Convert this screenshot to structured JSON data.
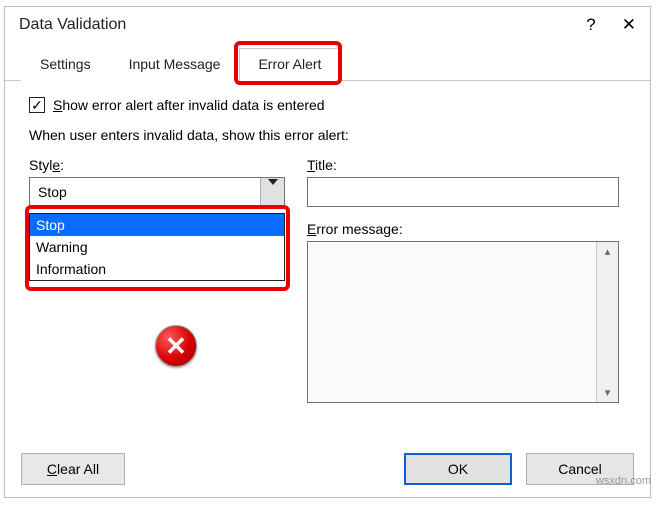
{
  "titlebar": {
    "title": "Data Validation"
  },
  "tabs": {
    "settings": "Settings",
    "input_message": "Input Message",
    "error_alert": "Error Alert"
  },
  "checkbox": {
    "prefix": "S",
    "rest": "how error alert after invalid data is entered"
  },
  "instruction": "When user enters invalid data, show this error alert:",
  "style": {
    "label_prefix": "Styl",
    "label_u": "e",
    "label_suffix": ":",
    "value": "Stop"
  },
  "dropdown": {
    "opt0": "Stop",
    "opt1": "Warning",
    "opt2": "Information"
  },
  "title_field": {
    "u": "T",
    "rest": "itle:",
    "value": ""
  },
  "errmsg": {
    "u": "E",
    "rest": "rror message:",
    "value": ""
  },
  "buttons": {
    "clear_u": "C",
    "clear_rest": "lear All",
    "ok": "OK",
    "cancel": "Cancel"
  },
  "watermark": "wsxdn.com"
}
